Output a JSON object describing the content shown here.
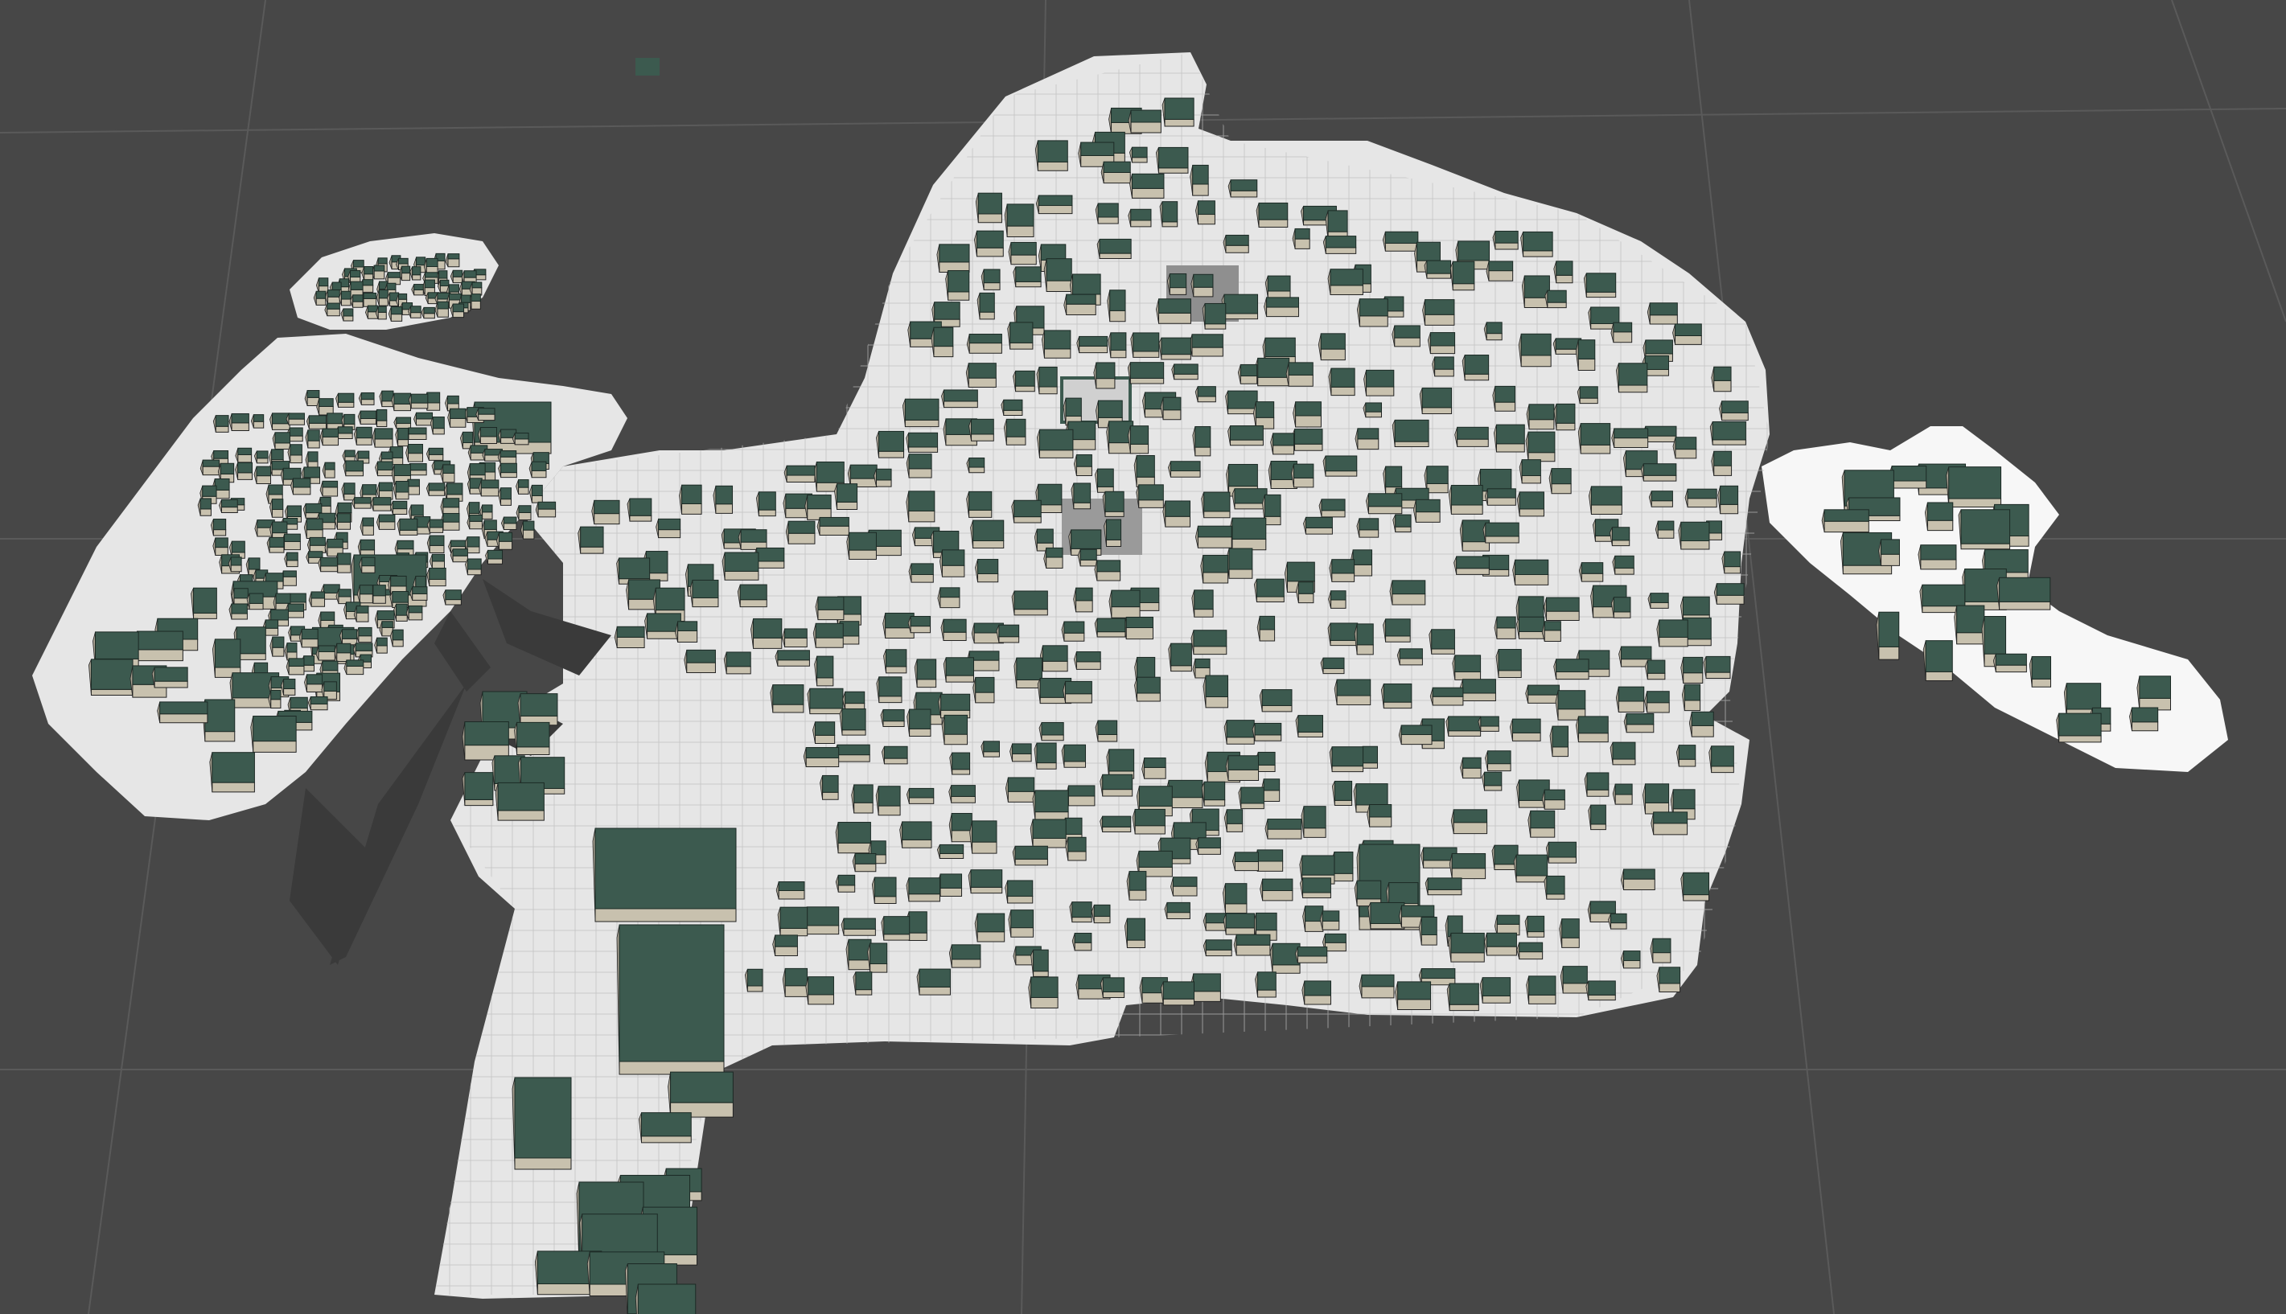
{
  "scene": {
    "kind": "3d-city-model-viewport",
    "colors": {
      "background": "#474747",
      "grid_line": "#5a5a5a",
      "ground": "#e6e6e6",
      "island_ground": "#f7f7f7",
      "roof": "#3c5a4f",
      "wall": "#c8c1ae",
      "wall_dark": "#a9a292",
      "plaza": "#9a9a9a",
      "shadow": "#2f2f2f"
    },
    "icons": []
  }
}
